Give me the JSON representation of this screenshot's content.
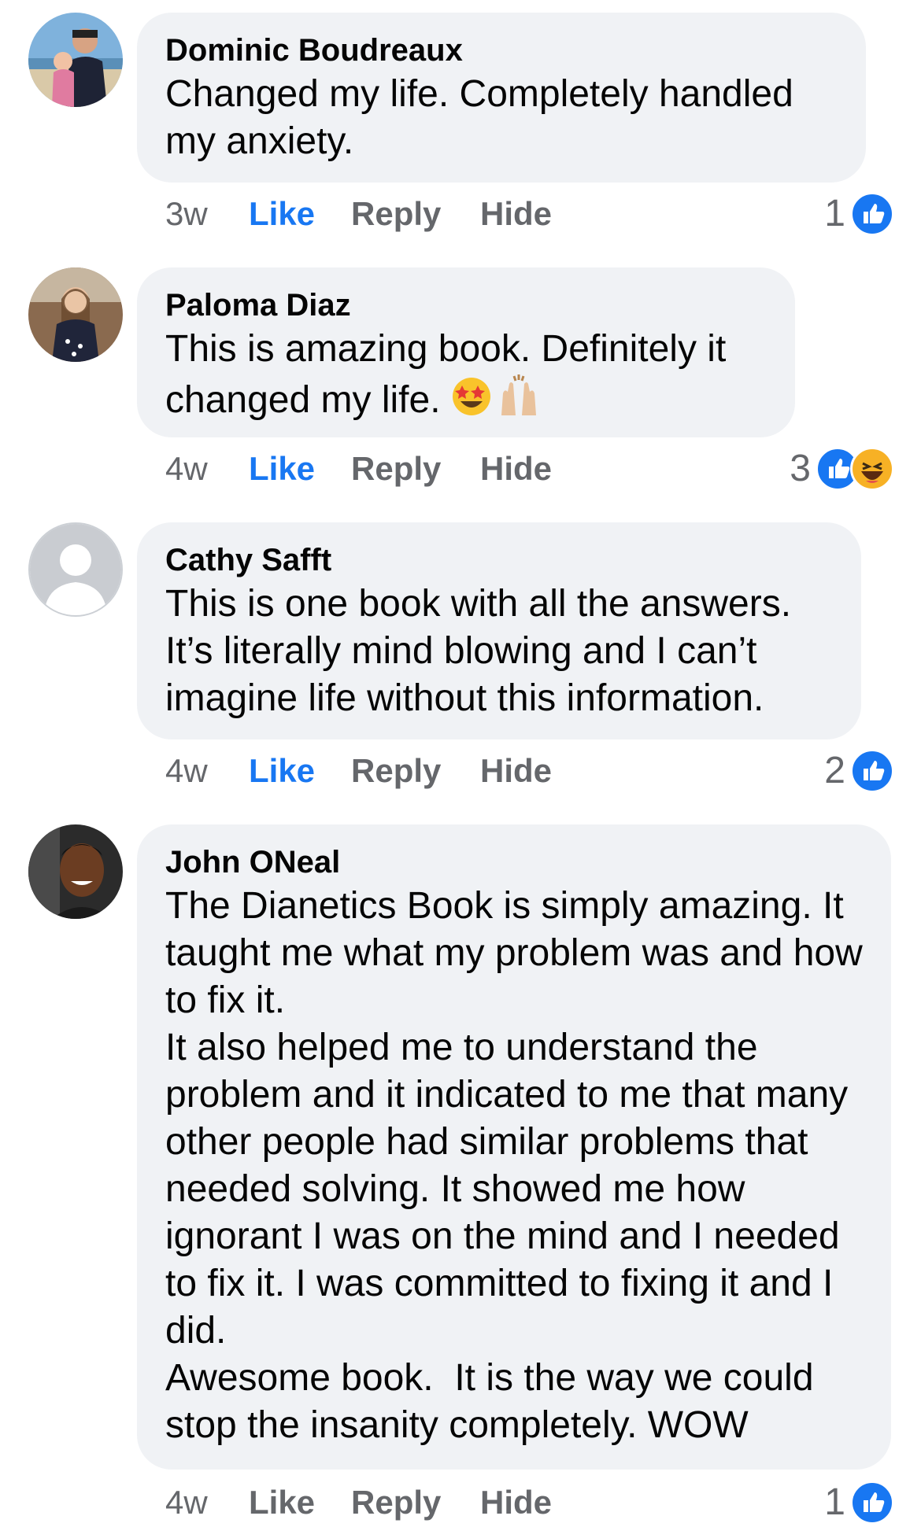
{
  "colors": {
    "like_blue": "#1877f2",
    "bubble_bg": "#f0f2f5",
    "meta_grey": "#65676b"
  },
  "comments": [
    {
      "author": "Dominic Boudreaux",
      "text": "Changed my life. Completely handled my anxiety.",
      "time": "3w",
      "like_label": "Like",
      "liked": true,
      "reply_label": "Reply",
      "hide_label": "Hide",
      "reaction_count": "1",
      "reactions": [
        "like-icon"
      ],
      "avatar": "photo-avatar"
    },
    {
      "author": "Paloma Diaz",
      "text": "This is amazing book. Definitely it changed my life.",
      "emojis": [
        "star-struck-emoji",
        "raising-hands-emoji"
      ],
      "time": "4w",
      "like_label": "Like",
      "liked": true,
      "reply_label": "Reply",
      "hide_label": "Hide",
      "reaction_count": "3",
      "reactions": [
        "like-icon",
        "haha-icon"
      ],
      "avatar": "photo-avatar"
    },
    {
      "author": "Cathy Safft",
      "text": "This is one book with all the answers. It’s literally mind blowing and I can’t imagine life without this information.",
      "time": "4w",
      "like_label": "Like",
      "liked": true,
      "reply_label": "Reply",
      "hide_label": "Hide",
      "reaction_count": "2",
      "reactions": [
        "like-icon"
      ],
      "avatar": "default-avatar"
    },
    {
      "author": "John ONeal",
      "text": "The Dianetics Book is simply amazing. It taught me what my problem was and how to fix it.\nIt also helped me to understand the problem and it indicated to me that many other people had similar problems that needed solving. It showed me how ignorant I was on the mind and I needed to fix it. I was committed to fixing it and I did.\nAwesome book.  It is the way we could stop the insanity completely. WOW",
      "time": "4w",
      "like_label": "Like",
      "liked": false,
      "reply_label": "Reply",
      "hide_label": "Hide",
      "reaction_count": "1",
      "reactions": [
        "like-icon"
      ],
      "avatar": "photo-avatar"
    }
  ]
}
